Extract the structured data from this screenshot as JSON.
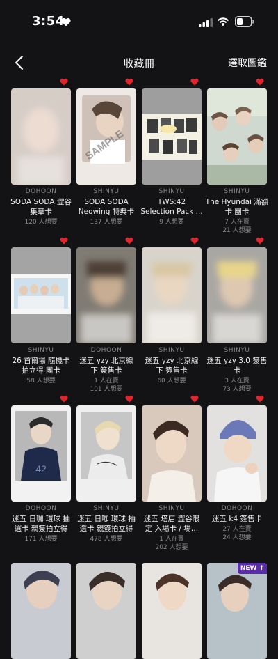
{
  "status_bar": {
    "time": "3:54"
  },
  "header": {
    "title": "收藏冊",
    "action_label": "選取圖鑑"
  },
  "new_badge_label": "NEW",
  "cards": [
    {
      "member": "DOHOON",
      "name1": "SODA SODA 澀谷",
      "name2": "集章卡",
      "stat1": "120 人想要",
      "stat2": ""
    },
    {
      "member": "SHINYU",
      "name1": "SODA SODA",
      "name2": "Neowing 特典卡",
      "stat1": "137 人想要",
      "stat2": ""
    },
    {
      "member": "SHINYU",
      "name1": "TWS:42",
      "name2": "Selection Pack ...",
      "stat1": "9 人想要",
      "stat2": ""
    },
    {
      "member": "SHINYU",
      "name1": "The Hyundai 滿額",
      "name2": "卡 團卡",
      "stat1": "7 人在賣",
      "stat2": "21 人想要"
    },
    {
      "member": "SHINYU",
      "name1": "26 首爾場 隨機卡",
      "name2": "拍立得 團卡",
      "stat1": "58 人想要",
      "stat2": ""
    },
    {
      "member": "DOHOON",
      "name1": "迷五 yzy 北京線",
      "name2": "下 簽售卡",
      "stat1": "1 人在賣",
      "stat2": "101 人想要"
    },
    {
      "member": "SHINYU",
      "name1": "迷五 yzy 北京線",
      "name2": "下 簽售卡",
      "stat1": "60 人想要",
      "stat2": ""
    },
    {
      "member": "SHINYU",
      "name1": "迷五 yzy 3.0 簽售",
      "name2": "卡",
      "stat1": "3 人在賣",
      "stat2": "73 人想要"
    },
    {
      "member": "DOHOON",
      "name1": "迷五 日咖 環球 抽",
      "name2": "選卡 親簽拍立得",
      "stat1": "171 人想要",
      "stat2": ""
    },
    {
      "member": "SHINYU",
      "name1": "迷五 日咖 環球 抽",
      "name2": "選卡 親簽拍立得",
      "stat1": "478 人想要",
      "stat2": ""
    },
    {
      "member": "SHINYU",
      "name1": "迷五 塔店 澀谷限",
      "name2": "定 入場卡 / 場…",
      "stat1": "1 人在賣",
      "stat2": "202 人想要"
    },
    {
      "member": "DOHOON",
      "name1": "迷五 k4 簽售卡",
      "name2": "",
      "stat1": "27 人在賣",
      "stat2": "24 人想要"
    }
  ]
}
